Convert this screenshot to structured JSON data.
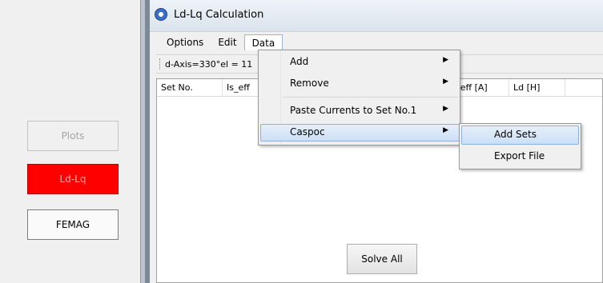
{
  "side": {
    "plots_label": "Plots",
    "ldlq_label": "Ld-Lq",
    "femag_label": "FEMAG"
  },
  "window": {
    "title": "Ld-Lq Calculation"
  },
  "menubar": {
    "options": "Options",
    "edit": "Edit",
    "data": "Data"
  },
  "toolbar": {
    "text": "d-Axis=330°el = 11"
  },
  "table": {
    "columns": [
      "Set No.",
      "Is_eff",
      "Iq_eff [A]",
      "Ld [H]"
    ]
  },
  "solve_all_label": "Solve All",
  "data_menu": {
    "items": [
      {
        "label": "Add",
        "submenu": true
      },
      {
        "label": "Remove",
        "submenu": true
      },
      {
        "label": "Paste Currents to Set No.1",
        "submenu": true
      },
      {
        "label": "Caspoc",
        "submenu": true
      }
    ]
  },
  "caspoc_menu": {
    "items": [
      "Add Sets",
      "Export File"
    ]
  }
}
